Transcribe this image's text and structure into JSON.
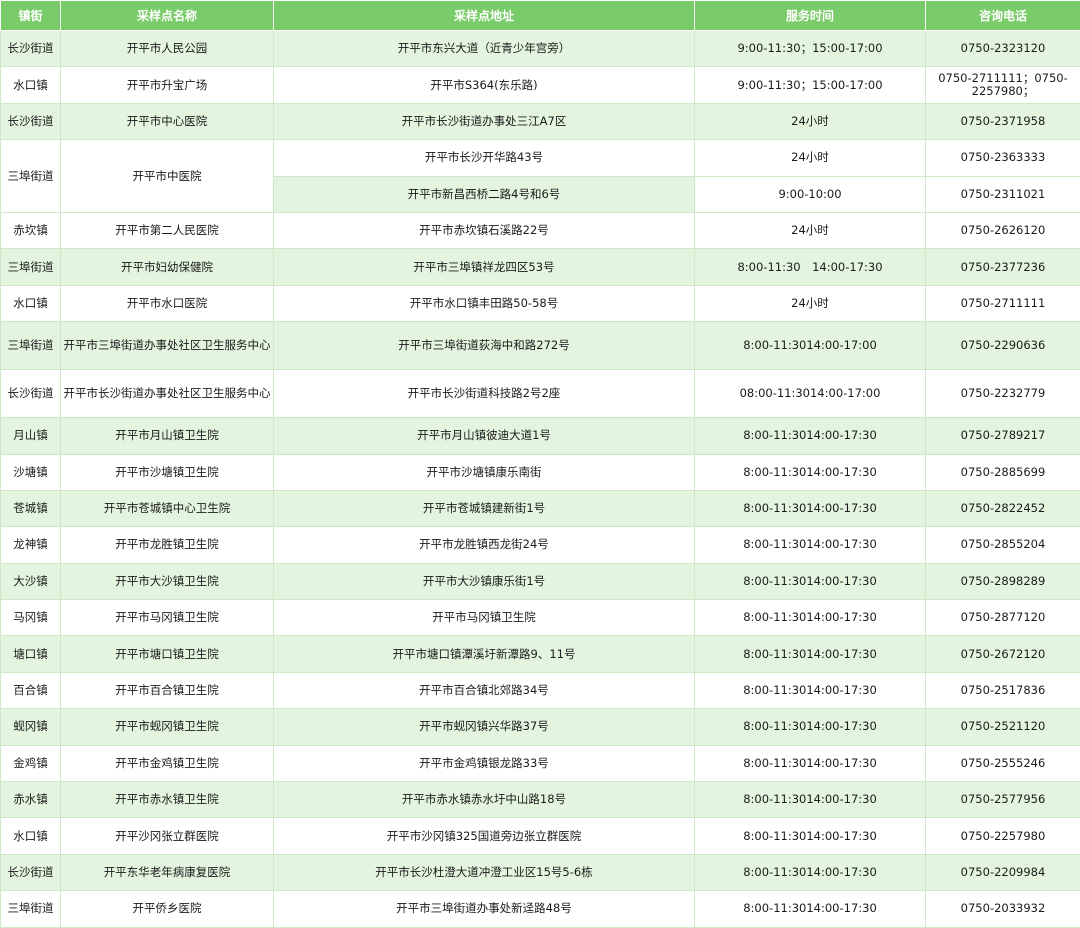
{
  "headers": [
    "镇街",
    "采样点名称",
    "采样点地址",
    "服务时间",
    "咨询电话"
  ],
  "rows": [
    {
      "town": "长沙街道",
      "name": "开平市人民公园",
      "addr": "开平市东兴大道（近青少年宫旁）",
      "time": "9:00-11:30；15:00-17:00",
      "phone": "0750-2323120"
    },
    {
      "town": "水口镇",
      "name": "开平市升宝广场",
      "addr": "开平市S364(东乐路)",
      "time": "9:00-11:30；15:00-17:00",
      "phone": "0750-2711111；0750-2257980；"
    },
    {
      "town": "长沙街道",
      "name": "开平市中心医院",
      "addr": "开平市长沙街道办事处三江A7区",
      "time": "24小时",
      "phone": "0750-2371958"
    },
    {
      "town": "三埠街道",
      "name": "开平市中医院",
      "addr": "开平市长沙开华路43号",
      "time": "24小时",
      "phone": "0750-2363333"
    },
    {
      "town": "",
      "name": "",
      "addr": "开平市新昌西桥二路4号和6号",
      "time": "9:00-10:00",
      "phone": "0750-2311021"
    },
    {
      "town": "赤坎镇",
      "name": "开平市第二人民医院",
      "addr": "开平市赤坎镇石溪路22号",
      "time": "24小时",
      "phone": "0750-2626120"
    },
    {
      "town": "三埠街道",
      "name": "开平市妇幼保健院",
      "addr": "开平市三埠镇祥龙四区53号",
      "time": "8:00-11:30　14:00-17:30",
      "phone": "0750-2377236"
    },
    {
      "town": "水口镇",
      "name": "开平市水口医院",
      "addr": "开平市水口镇丰田路50-58号",
      "time": "24小时",
      "phone": "0750-2711111"
    },
    {
      "town": "三埠街道",
      "name": "开平市三埠街道办事处社区卫生服务中心",
      "addr": "开平市三埠街道荻海中和路272号",
      "time": "8:00-11:3014:00-17:00",
      "phone": "0750-2290636"
    },
    {
      "town": "长沙街道",
      "name": "开平市长沙街道办事处社区卫生服务中心",
      "addr": "开平市长沙街道科技路2号2座",
      "time": "08:00-11:3014:00-17:00",
      "phone": "0750-2232779"
    },
    {
      "town": "月山镇",
      "name": "开平市月山镇卫生院",
      "addr": "开平市月山镇彼迪大道1号",
      "time": "8:00-11:3014:00-17:30",
      "phone": "0750-2789217"
    },
    {
      "town": "沙塘镇",
      "name": "开平市沙塘镇卫生院",
      "addr": "开平市沙塘镇康乐南街",
      "time": "8:00-11:3014:00-17:30",
      "phone": "0750-2885699"
    },
    {
      "town": "苍城镇",
      "name": "开平市苍城镇中心卫生院",
      "addr": "开平市苍城镇建新街1号",
      "time": "8:00-11:3014:00-17:30",
      "phone": "0750-2822452"
    },
    {
      "town": "龙神镇",
      "name": "开平市龙胜镇卫生院",
      "addr": "开平市龙胜镇西龙街24号",
      "time": "8:00-11:3014:00-17:30",
      "phone": "0750-2855204"
    },
    {
      "town": "大沙镇",
      "name": "开平市大沙镇卫生院",
      "addr": "开平市大沙镇康乐街1号",
      "time": "8:00-11:3014:00-17:30",
      "phone": "0750-2898289"
    },
    {
      "town": "马冈镇",
      "name": "开平市马冈镇卫生院",
      "addr": "开平市马冈镇卫生院",
      "time": "8:00-11:3014:00-17:30",
      "phone": "0750-2877120"
    },
    {
      "town": "塘口镇",
      "name": "开平市塘口镇卫生院",
      "addr": "开平市塘口镇潭溪圩新潭路9、11号",
      "time": "8:00-11:3014:00-17:30",
      "phone": "0750-2672120"
    },
    {
      "town": "百合镇",
      "name": "开平市百合镇卫生院",
      "addr": "开平市百合镇北郊路34号",
      "time": "8:00-11:3014:00-17:30",
      "phone": "0750-2517836"
    },
    {
      "town": "蚬冈镇",
      "name": "开平市蚬冈镇卫生院",
      "addr": "开平市蚬冈镇兴华路37号",
      "time": "8:00-11:3014:00-17:30",
      "phone": "0750-2521120"
    },
    {
      "town": "金鸡镇",
      "name": "开平市金鸡镇卫生院",
      "addr": "开平市金鸡镇银龙路33号",
      "time": "8:00-11:3014:00-17:30",
      "phone": "0750-2555246"
    },
    {
      "town": "赤水镇",
      "name": "开平市赤水镇卫生院",
      "addr": "开平市赤水镇赤水圩中山路18号",
      "time": "8:00-11:3014:00-17:30",
      "phone": "0750-2577956"
    },
    {
      "town": "水口镇",
      "name": "开平沙冈张立群医院",
      "addr": "开平市沙冈镇325国道旁边张立群医院",
      "time": "8:00-11:3014:00-17:30",
      "phone": "0750-2257980"
    },
    {
      "town": "长沙街道",
      "name": "开平东华老年病康复医院",
      "addr": "开平市长沙杜澄大道冲澄工业区15号5-6栋",
      "time": "8:00-11:3014:00-17:30",
      "phone": "0750-2209984"
    },
    {
      "town": "三埠街道",
      "name": "开平侨乡医院",
      "addr": "开平市三埠街道办事处新迳路48号",
      "time": "8:00-11:3014:00-17:30",
      "phone": "0750-2033932"
    }
  ]
}
